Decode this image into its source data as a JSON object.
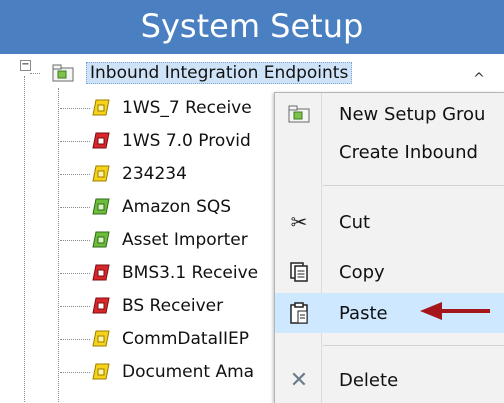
{
  "header": {
    "title": "System Setup"
  },
  "tree": {
    "root": {
      "label": "Inbound Integration Endpoints"
    },
    "items": [
      {
        "label": "1WS_7 Receive",
        "color": "yellow"
      },
      {
        "label": "1WS 7.0 Provid",
        "color": "red"
      },
      {
        "label": "234234",
        "color": "yellow"
      },
      {
        "label": "Amazon SQS",
        "color": "green"
      },
      {
        "label": "Asset Importer",
        "color": "green"
      },
      {
        "label": "BMS3.1 Receive",
        "color": "red"
      },
      {
        "label": "BS Receiver",
        "color": "red"
      },
      {
        "label": "CommDataIIEP",
        "color": "yellow"
      },
      {
        "label": "Document Ama",
        "color": "yellow"
      }
    ],
    "scroll_up_glyph": "^"
  },
  "context_menu": {
    "items": [
      {
        "label": "New Setup Grou",
        "icon": "folder-new-icon"
      },
      {
        "label": "Create Inbound",
        "icon": ""
      },
      {
        "label": "Cut",
        "icon": "scissors-icon"
      },
      {
        "label": "Copy",
        "icon": "copy-icon"
      },
      {
        "label": "Paste",
        "icon": "clipboard-paste-icon"
      },
      {
        "label": "Delete",
        "icon": "delete-x-icon"
      }
    ]
  },
  "colors": {
    "header_bg": "#4a7fc1",
    "menu_hover": "#cde8ff",
    "arrow": "#a4161a",
    "icon_yellow": "#f6d21b",
    "icon_red": "#d8262b",
    "icon_green": "#6cbd3c"
  }
}
